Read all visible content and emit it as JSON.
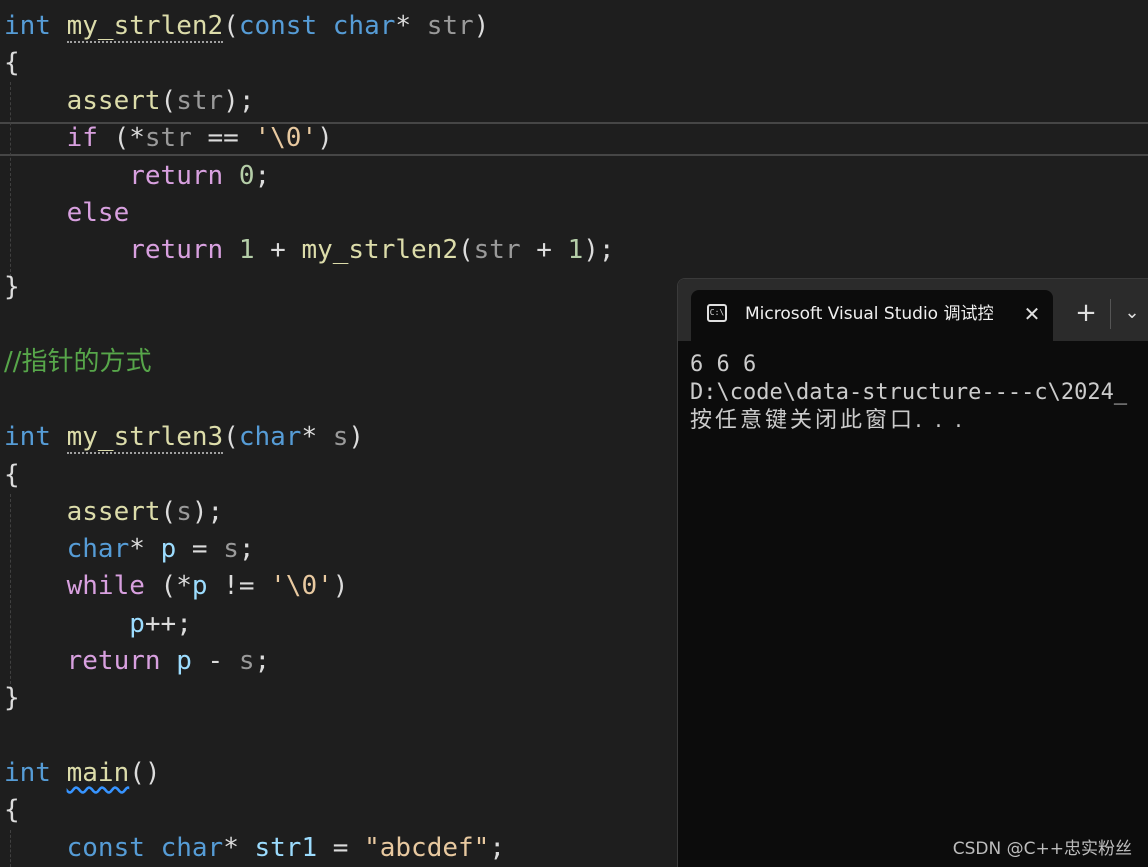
{
  "editor": {
    "lines": {
      "l1": {
        "kw": "int",
        "fn": "my_strlen2",
        "open": "(",
        "kw2": "const",
        "kw3": "char",
        "star": "*",
        "param": "str",
        "close": ")"
      },
      "l2": {
        "text": "{"
      },
      "l3": {
        "fn": "assert",
        "open": "(",
        "param": "str",
        "close": ");"
      },
      "l4": {
        "ctrl": "if",
        "open": " (*",
        "param": "str",
        "op": " == ",
        "chr": "'\\0'",
        "close": ")"
      },
      "l5": {
        "ctrl": "return",
        "num": "0",
        "semi": ";"
      },
      "l6": {
        "ctrl": "else"
      },
      "l7": {
        "ctrl": "return",
        "num": "1",
        "op": " + ",
        "fn": "my_strlen2",
        "open": "(",
        "param": "str",
        "op2": " + ",
        "num2": "1",
        "close": ");"
      },
      "l8": {
        "text": "}"
      },
      "l9": {
        "comment": "//指针的方式"
      },
      "l10": {
        "kw": "int",
        "fn": "my_strlen3",
        "open": "(",
        "kw2": "char",
        "star": "*",
        "param": "s",
        "close": ")"
      },
      "l11": {
        "text": "{"
      },
      "l12": {
        "fn": "assert",
        "open": "(",
        "param": "s",
        "close": ");"
      },
      "l13": {
        "kw": "char",
        "star": "*",
        "var": "p",
        "op": " = ",
        "param": "s",
        "semi": ";"
      },
      "l14": {
        "ctrl": "while",
        "open": " (*",
        "var": "p",
        "op": " != ",
        "chr": "'\\0'",
        "close": ")"
      },
      "l15": {
        "var": "p",
        "op": "++",
        "semi": ";"
      },
      "l16": {
        "ctrl": "return",
        "var": "p",
        "op": " - ",
        "param": "s",
        "semi": ";"
      },
      "l17": {
        "text": "}"
      },
      "l18": {
        "kw": "int",
        "fn": "main",
        "paren": "()"
      },
      "l19": {
        "text": "{"
      },
      "l20": {
        "kw": "const",
        "kw2": "char",
        "star": "*",
        "var": "str1",
        "op": " = ",
        "str": "\"abcdef\"",
        "semi": ";"
      }
    }
  },
  "console": {
    "tab_icon": "C:\\",
    "tab_icon_name": "console-icon",
    "tab_title": "Microsoft Visual Studio 调试控制台",
    "close_glyph": "✕",
    "new_tab_glyph": "+",
    "dropdown_glyph": "⌄",
    "output": {
      "line1": "6 6 6",
      "line2": "D:\\code\\data-structure----c\\2024_",
      "line3": "按任意键关闭此窗口. . ."
    }
  },
  "watermark": "CSDN @C++忠实粉丝"
}
